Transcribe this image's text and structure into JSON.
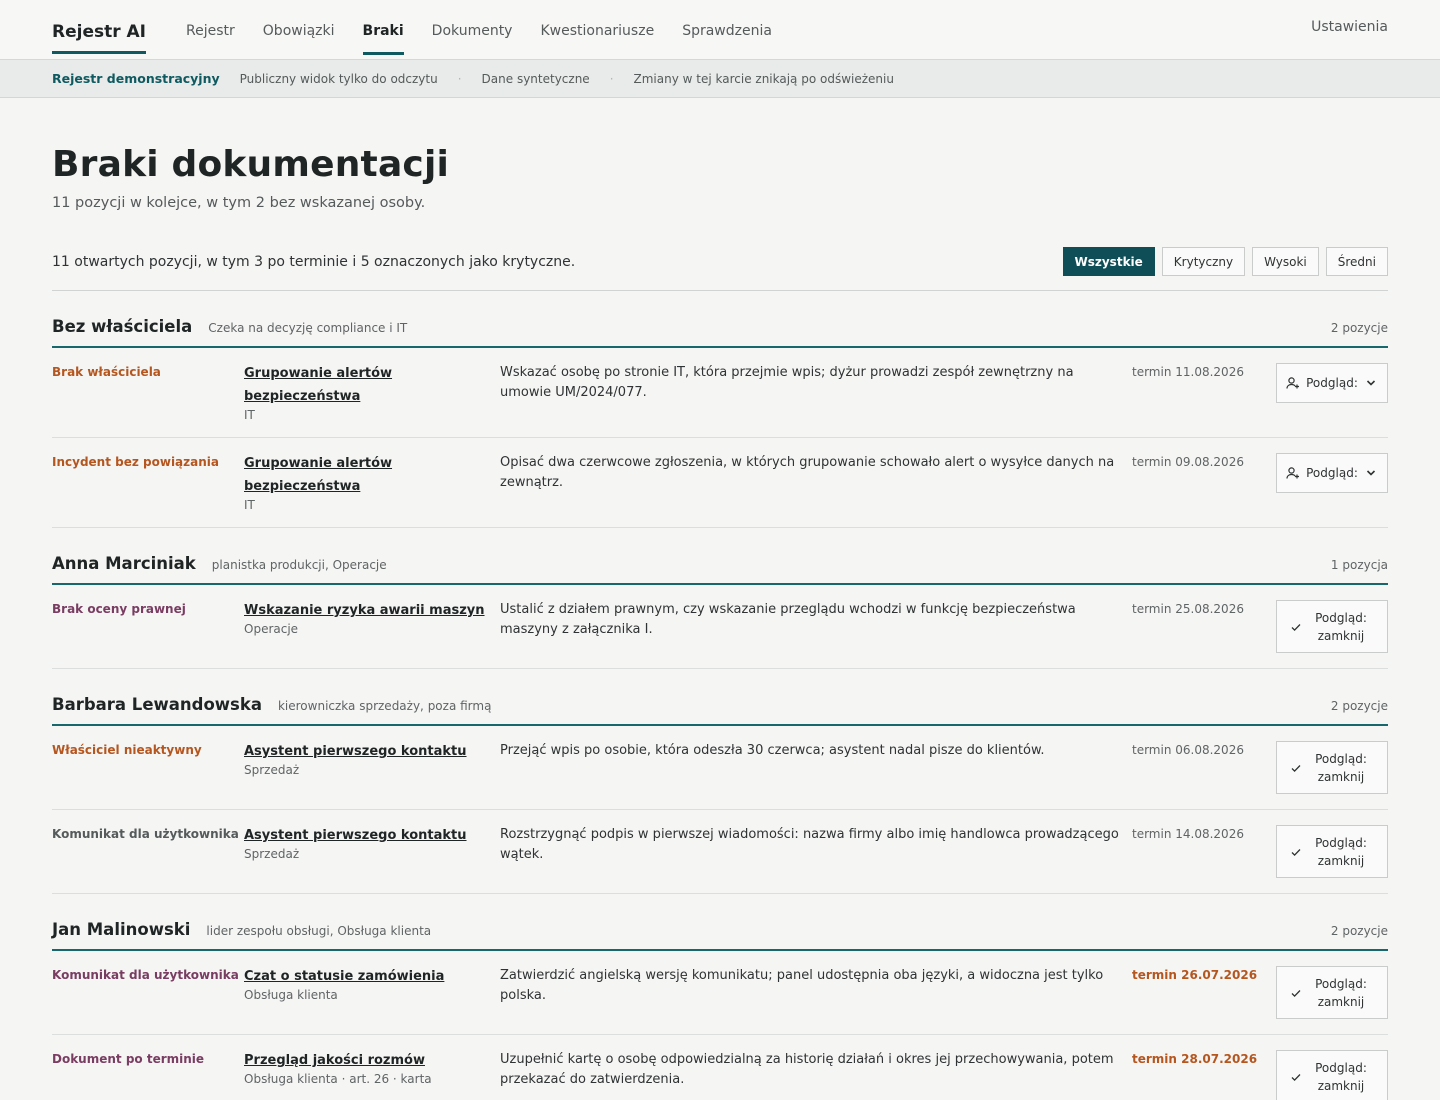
{
  "nav": {
    "brand": "Rejestr AI",
    "links": [
      "Rejestr",
      "Obowiązki",
      "Braki",
      "Dokumenty",
      "Kwestionariusze",
      "Sprawdzenia"
    ],
    "active_index": 2,
    "settings": "Ustawienia"
  },
  "demo": {
    "title": "Rejestr demonstracyjny",
    "items": [
      "Publiczny widok tylko do odczytu",
      "Dane syntetyczne",
      "Zmiany w tej karcie znikają po odświeżeniu"
    ],
    "separator": "·"
  },
  "page": {
    "title": "Braki dokumentacji",
    "subtitle": "11 pozycji w kolejce, w tym 2 bez wskazanej osoby.",
    "summary": "11 otwartych pozycji, w tym 3 po terminie i 5 oznaczonych jako krytyczne."
  },
  "filters": [
    "Wszystkie",
    "Krytyczny",
    "Wysoki",
    "Średni"
  ],
  "groups": [
    {
      "name": "Bez właściciela",
      "role": "Czeka na decyzję compliance i IT",
      "count": "2 pozycje",
      "rows": [
        {
          "kind": "Brak właściciela",
          "tone": "orange",
          "system": "Grupowanie alertów bezpieczeństwa",
          "dept": "IT",
          "desc": "Wskazać osobę po stronie IT, która przejmie wpis; dyżur prowadzi zespół zewnętrzny na umowie UM/2024/077.",
          "due": "termin 11.08.2026",
          "late": false,
          "action": "assign",
          "action_label": "Podgląd:"
        },
        {
          "kind": "Incydent bez powiązania",
          "tone": "orange",
          "system": "Grupowanie alertów bezpieczeństwa",
          "dept": "IT",
          "desc": "Opisać dwa czerwcowe zgłoszenia, w których grupowanie schowało alert o wysyłce danych na zewnątrz.",
          "due": "termin 09.08.2026",
          "late": false,
          "action": "assign",
          "action_label": "Podgląd:"
        }
      ]
    },
    {
      "name": "Anna Marciniak",
      "role": "planistka produkcji, Operacje",
      "count": "1 pozycja",
      "rows": [
        {
          "kind": "Brak oceny prawnej",
          "tone": "plum",
          "system": "Wskazanie ryzyka awarii maszyn",
          "dept": "Operacje",
          "desc": "Ustalić z działem prawnym, czy wskazanie przeglądu wchodzi w funkcję bezpieczeństwa maszyny z załącznika I.",
          "due": "termin 25.08.2026",
          "late": false,
          "action": "close",
          "action_label": "Podgląd: zamknij"
        }
      ]
    },
    {
      "name": "Barbara Lewandowska",
      "role": "kierowniczka sprzedaży, poza firmą",
      "count": "2 pozycje",
      "rows": [
        {
          "kind": "Właściciel nieaktywny",
          "tone": "orange",
          "system": "Asystent pierwszego kontaktu",
          "dept": "Sprzedaż",
          "desc": "Przejąć wpis po osobie, która odeszła 30 czerwca; asystent nadal pisze do klientów.",
          "due": "termin 06.08.2026",
          "late": false,
          "action": "close",
          "action_label": "Podgląd: zamknij"
        },
        {
          "kind": "Komunikat dla użytkownika",
          "tone": "gray",
          "system": "Asystent pierwszego kontaktu",
          "dept": "Sprzedaż",
          "desc": "Rozstrzygnąć podpis w pierwszej wiadomości: nazwa firmy albo imię handlowca prowadzącego wątek.",
          "due": "termin 14.08.2026",
          "late": false,
          "action": "close",
          "action_label": "Podgląd: zamknij"
        }
      ]
    },
    {
      "name": "Jan Malinowski",
      "role": "lider zespołu obsługi, Obsługa klienta",
      "count": "2 pozycje",
      "rows": [
        {
          "kind": "Komunikat dla użytkownika",
          "tone": "plum",
          "system": "Czat o statusie zamówienia",
          "dept": "Obsługa klienta",
          "desc": "Zatwierdzić angielską wersję komunikatu; panel udostępnia oba języki, a widoczna jest tylko polska.",
          "due": "termin 26.07.2026",
          "late": true,
          "action": "close",
          "action_label": "Podgląd: zamknij"
        },
        {
          "kind": "Dokument po terminie",
          "tone": "plum",
          "system": "Przegląd jakości rozmów",
          "dept": "Obsługa klienta · art. 26 · karta",
          "desc": "Uzupełnić kartę o osobę odpowiedzialną za historię działań i okres jej przechowywania, potem przekazać do zatwierdzenia.",
          "due": "termin 28.07.2026",
          "late": true,
          "action": "close",
          "action_label": "Podgląd: zamknij"
        }
      ]
    }
  ],
  "icons": {
    "assign": "user-plus-icon",
    "close": "check-icon",
    "dropdown": "chevron-down-icon"
  },
  "colors": {
    "accent": "#0f5a60",
    "orange": "#b5561f",
    "plum": "#7a3d62"
  }
}
